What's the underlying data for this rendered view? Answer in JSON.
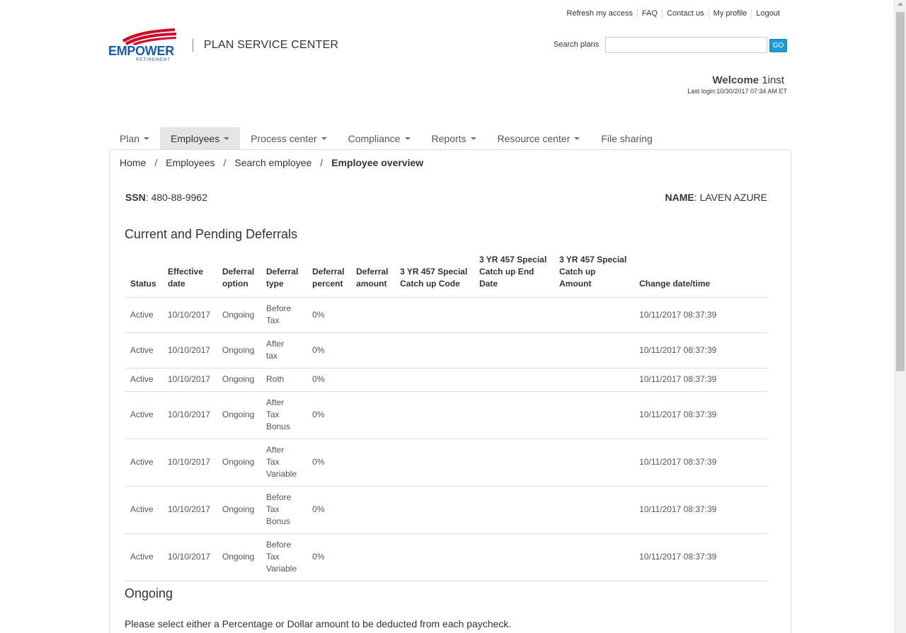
{
  "toplinks": [
    "Refresh my access",
    "FAQ",
    "Contact us",
    "My profile",
    "Logout"
  ],
  "logo": {
    "wordmark": "EMPOWER",
    "sub": "RETIREMENT",
    "brand_color": "#1a5aa6",
    "accent_color": "#c8102e"
  },
  "header": {
    "title": "PLAN SERVICE CENTER"
  },
  "search": {
    "label": "Search plans",
    "value": "",
    "placeholder": "",
    "button": "GO"
  },
  "welcome": {
    "prefix": "Welcome",
    "user": "1inst",
    "last_login": "Last login:10/30/2017 07:34 AM ET"
  },
  "nav": [
    {
      "label": "Plan",
      "dropdown": true,
      "active": false
    },
    {
      "label": "Employees",
      "dropdown": true,
      "active": true
    },
    {
      "label": "Process center",
      "dropdown": true,
      "active": false
    },
    {
      "label": "Compliance",
      "dropdown": true,
      "active": false
    },
    {
      "label": "Reports",
      "dropdown": true,
      "active": false
    },
    {
      "label": "Resource center",
      "dropdown": true,
      "active": false
    },
    {
      "label": "File sharing",
      "dropdown": false,
      "active": false
    }
  ],
  "breadcrumb": {
    "items": [
      "Home",
      "Employees",
      "Search employee"
    ],
    "current": "Employee overview"
  },
  "employee": {
    "ssn_label": "SSN",
    "ssn": "480-88-9962",
    "name_label": "NAME",
    "name": "LAVEN AZURE"
  },
  "deferrals": {
    "title": "Current and Pending Deferrals",
    "headers": [
      "Status",
      "Effective date",
      "Deferral option",
      "Deferral type",
      "Deferral percent",
      "Deferral amount",
      "3 YR 457 Special Catch up Code",
      "3 YR 457 Special Catch up End Date",
      "3 YR 457 Special Catch up Amount",
      "Change date/time"
    ],
    "rows": [
      [
        "Active",
        "10/10/2017",
        "Ongoing",
        "Before Tax",
        "0%",
        "",
        "",
        "",
        "",
        "10/11/2017 08:37:39"
      ],
      [
        "Active",
        "10/10/2017",
        "Ongoing",
        "After tax",
        "0%",
        "",
        "",
        "",
        "",
        "10/11/2017 08:37:39"
      ],
      [
        "Active",
        "10/10/2017",
        "Ongoing",
        "Roth",
        "0%",
        "",
        "",
        "",
        "",
        "10/11/2017 08:37:39"
      ],
      [
        "Active",
        "10/10/2017",
        "Ongoing",
        "After Tax Bonus",
        "0%",
        "",
        "",
        "",
        "",
        "10/11/2017 08:37:39"
      ],
      [
        "Active",
        "10/10/2017",
        "Ongoing",
        "After Tax Variable",
        "0%",
        "",
        "",
        "",
        "",
        "10/11/2017 08:37:39"
      ],
      [
        "Active",
        "10/10/2017",
        "Ongoing",
        "Before Tax Bonus",
        "0%",
        "",
        "",
        "",
        "",
        "10/11/2017 08:37:39"
      ],
      [
        "Active",
        "10/10/2017",
        "Ongoing",
        "Before Tax Variable",
        "0%",
        "",
        "",
        "",
        "",
        "10/11/2017 08:37:39"
      ]
    ]
  },
  "ongoing": {
    "title": "Ongoing",
    "instructions": "Please select either a Percentage or Dollar amount to be deducted from each paycheck."
  }
}
